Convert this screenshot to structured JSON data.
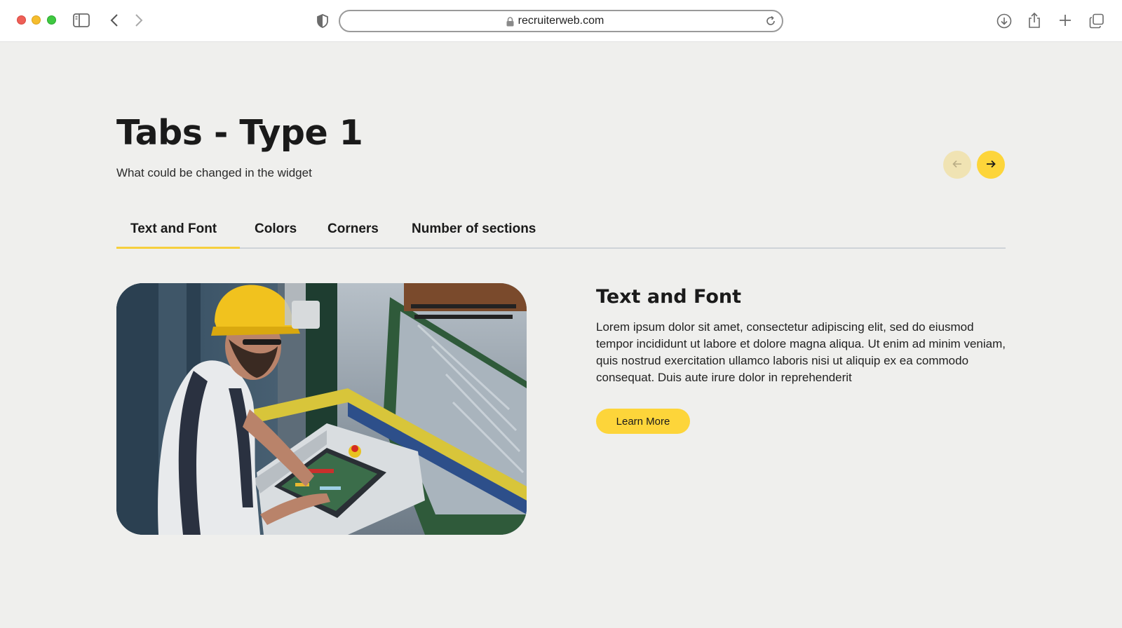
{
  "browser": {
    "url": "recruiterweb.com"
  },
  "page": {
    "title": "Tabs - Type 1",
    "subtitle": "What could be changed in the widget"
  },
  "tabs": [
    {
      "label": "Text and Font",
      "active": true
    },
    {
      "label": "Colors",
      "active": false
    },
    {
      "label": "Corners",
      "active": false
    },
    {
      "label": "Number of sections",
      "active": false
    }
  ],
  "content": {
    "heading": "Text and Font",
    "body": "Lorem ipsum dolor sit amet, consectetur adipiscing elit, sed do eiusmod tempor incididunt ut labore et dolore magna aliqua. Ut enim ad minim veniam, quis nostrud exercitation ullamco laboris nisi ut aliquip ex ea commodo consequat. Duis aute irure dolor in reprehenderit",
    "button_label": "Learn More"
  },
  "colors": {
    "accent": "#fdd53a",
    "accent_light": "#f0e3b3",
    "background": "#efefed"
  },
  "icons": {
    "prev": "arrow-left-icon",
    "next": "arrow-right-icon"
  }
}
